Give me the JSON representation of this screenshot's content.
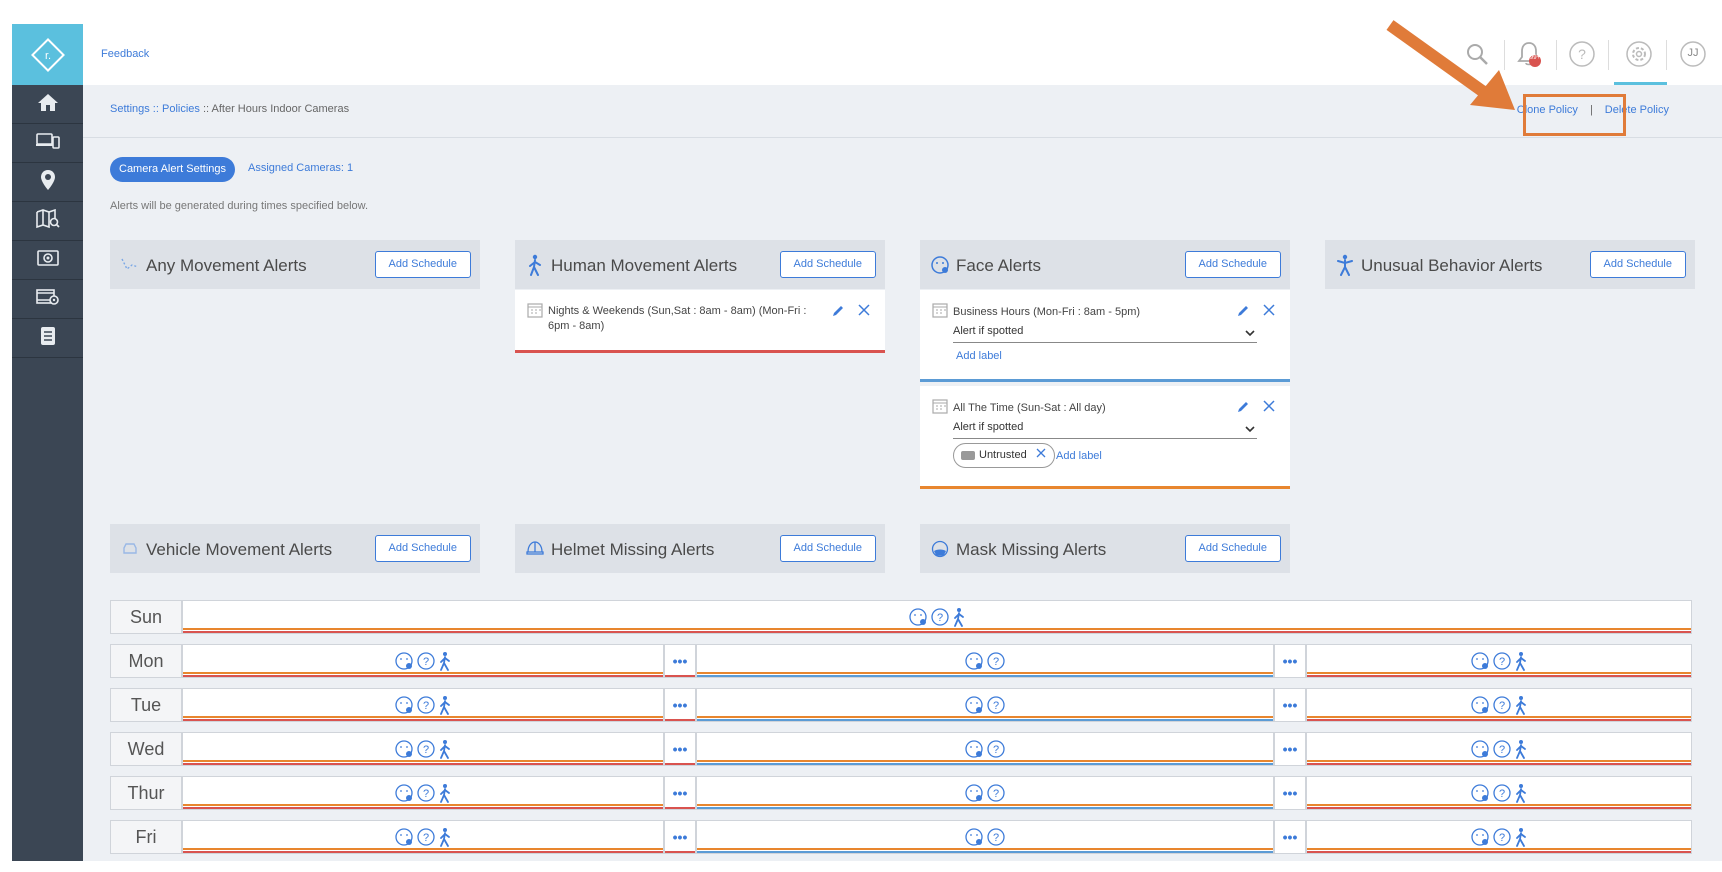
{
  "topbar": {
    "feedback": "Feedback",
    "notification_badge": "99+",
    "avatar_initials": "JJ"
  },
  "breadcrumb": {
    "settings": "Settings",
    "sep1": " :: ",
    "policies": "Policies",
    "sep2": " :: ",
    "current": "After Hours Indoor Cameras"
  },
  "actions": {
    "clone": "Clone Policy",
    "sep": "|",
    "delete": "Delete Policy"
  },
  "tabs": {
    "active": "Camera Alert Settings",
    "assigned": "Assigned Cameras: 1"
  },
  "info": "Alerts will be generated during times specified below.",
  "add_schedule": "Add Schedule",
  "cards": {
    "any": "Any Movement Alerts",
    "human": "Human Movement Alerts",
    "face": "Face Alerts",
    "unusual": "Unusual Behavior Alerts",
    "vehicle": "Vehicle Movement Alerts",
    "helmet": "Helmet Missing Alerts",
    "mask": "Mask Missing Alerts"
  },
  "schedules": {
    "human_1": "Nights & Weekends (Sun,Sat : 8am - 8am) (Mon-Fri : 6pm - 8am)",
    "face_1": "Business Hours (Mon-Fri : 8am - 5pm)",
    "face_1_select": "Alert if spotted",
    "face_1_addlabel": "Add label",
    "face_2": "All The Time (Sun-Sat : All day)",
    "face_2_select": "Alert if spotted",
    "face_2_chip": "Untrusted",
    "face_2_addlabel": "Add label"
  },
  "days": [
    "Sun",
    "Mon",
    "Tue",
    "Wed",
    "Thur",
    "Fri"
  ],
  "more_label": "•••",
  "colors": {
    "accent": "#3d7bd9",
    "sidebar": "#3b4654",
    "logo": "#5bc0de",
    "red": "#d9534f",
    "orange": "#e8862e",
    "blue": "#5b9bd5",
    "highlight": "#e07b39"
  }
}
